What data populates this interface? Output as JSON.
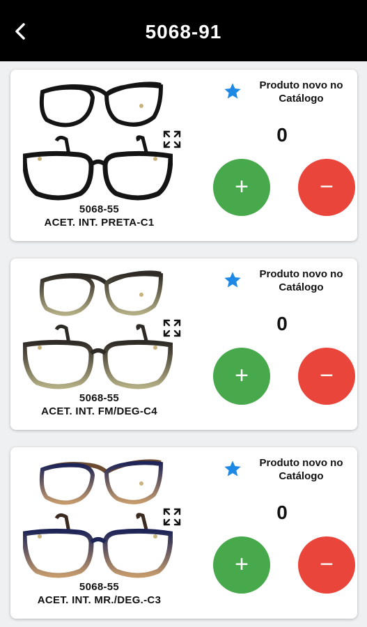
{
  "header": {
    "title": "5068-91"
  },
  "products": [
    {
      "model": "5068-55",
      "color_desc": "ACET. INT. PRETA-C1",
      "badge": "Produto novo no Catálogo",
      "quantity": "0",
      "plus": "+",
      "minus": "−",
      "frame_top": "#141414",
      "frame_bottom": "#141414"
    },
    {
      "model": "5068-55",
      "color_desc": "ACET. INT. FM/DEG-C4",
      "badge": "Produto novo no Catálogo",
      "quantity": "0",
      "plus": "+",
      "minus": "−",
      "frame_top": "#2e2a25",
      "frame_bottom": "#b3ad84"
    },
    {
      "model": "5068-55",
      "color_desc": "ACET. INT. MR./DEG.-C3",
      "badge": "Produto novo no Catálogo",
      "quantity": "0",
      "plus": "+",
      "minus": "−",
      "frame_top": "#1d2457",
      "frame_bottom": "#c49a6c"
    }
  ],
  "icons": {
    "back": "back-arrow-icon",
    "expand": "expand-icon",
    "star": "star-icon"
  },
  "colors": {
    "header_bg": "#000000",
    "plus": "#47a94c",
    "minus": "#e9453b",
    "star": "#1e88e5"
  }
}
